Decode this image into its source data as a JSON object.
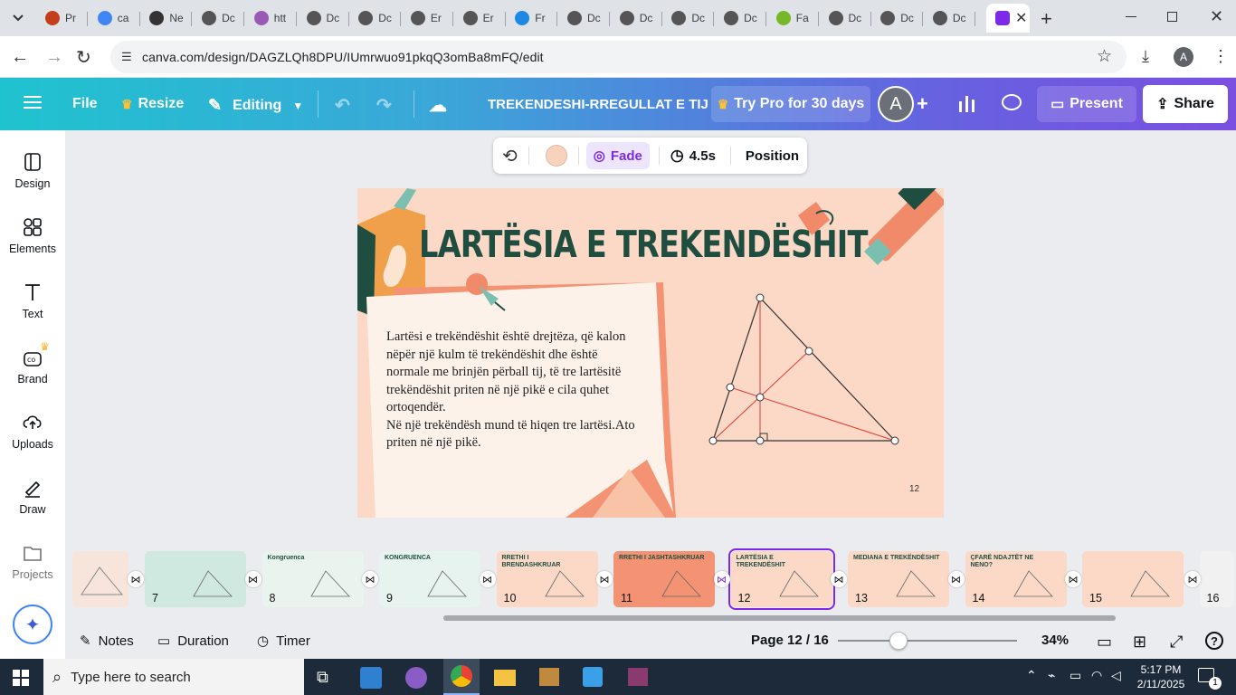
{
  "browser": {
    "tabs": [
      {
        "label": "Pr",
        "color": "#c43e1c"
      },
      {
        "label": "ca",
        "color": "#4285f4"
      },
      {
        "label": "Ne",
        "color": "#333333"
      },
      {
        "label": "Dc",
        "color": "#555555"
      },
      {
        "label": "htt",
        "color": "#9b59b6"
      },
      {
        "label": "Dc",
        "color": "#555555"
      },
      {
        "label": "Dc",
        "color": "#555555"
      },
      {
        "label": "Er",
        "color": "#555555"
      },
      {
        "label": "Er",
        "color": "#555555"
      },
      {
        "label": "Fr",
        "color": "#1e88e5"
      },
      {
        "label": "Dc",
        "color": "#555555"
      },
      {
        "label": "Dc",
        "color": "#555555"
      },
      {
        "label": "Dc",
        "color": "#555555"
      },
      {
        "label": "Dc",
        "color": "#555555"
      },
      {
        "label": "Fa",
        "color": "#76b82a"
      },
      {
        "label": "Dc",
        "color": "#555555"
      },
      {
        "label": "Dc",
        "color": "#555555"
      },
      {
        "label": "Dc",
        "color": "#555555"
      }
    ],
    "url": "canva.com/design/DAGZLQh8DPU/IUmrwuo91pkqQ3omBa8mFQ/edit",
    "profile_initial": "A"
  },
  "header": {
    "file": "File",
    "resize": "Resize",
    "editing": "Editing",
    "title": "TREKENDESHI-RREGULLAT E TIJ",
    "try_pro": "Try Pro for 30 days",
    "avatar": "A",
    "present": "Present",
    "share": "Share"
  },
  "sidebar": [
    {
      "label": "Design",
      "icon": "design-icon"
    },
    {
      "label": "Elements",
      "icon": "elements-icon"
    },
    {
      "label": "Text",
      "icon": "text-icon"
    },
    {
      "label": "Brand",
      "icon": "brand-icon"
    },
    {
      "label": "Uploads",
      "icon": "uploads-icon"
    },
    {
      "label": "Draw",
      "icon": "draw-icon"
    },
    {
      "label": "Projects",
      "icon": "projects-icon"
    }
  ],
  "toolbar": {
    "animation": "Fade",
    "duration": "4.5s",
    "position": "Position",
    "color": "#f8d2bd"
  },
  "slide": {
    "title": "LARTËSIA E TREKENDËSHIT",
    "paragraph1": "Lartësi e trekëndëshit është drejtëza, që kalon nëpër një kulm të trekëndëshit dhe është normale me brinjën përball tij, të tre lartësitë trekëndëshit priten në një pikë e cila quhet ortoqendër.",
    "paragraph2": "Në një trekëndësh mund të hiqen tre lartësi.Ato priten në një pikë.",
    "page_number": "12"
  },
  "filmstrip": [
    {
      "num": "7",
      "title": ""
    },
    {
      "num": "8",
      "title": "Kongruenca"
    },
    {
      "num": "9",
      "title": "KONGRUENCA"
    },
    {
      "num": "10",
      "title": "RRETHI I BRENDASHKRUAR"
    },
    {
      "num": "11",
      "title": "RRETHI I JASHTASHKRUAR"
    },
    {
      "num": "12",
      "title": "LARTËSIA E TREKENDËSHIT"
    },
    {
      "num": "13",
      "title": "MEDIANA E TREKËNDËSHIT"
    },
    {
      "num": "14",
      "title": "ÇFARË NDAJTËT NE NENO?"
    },
    {
      "num": "15",
      "title": ""
    },
    {
      "num": "16",
      "title": ""
    }
  ],
  "footer": {
    "notes": "Notes",
    "duration": "Duration",
    "timer": "Timer",
    "page": "Page 12 / 16",
    "zoom": "34%",
    "zoom_fraction": 0.34
  },
  "taskbar": {
    "search_placeholder": "Type here to search",
    "time": "5:17 PM",
    "date": "2/11/2025",
    "notifications": "1"
  }
}
